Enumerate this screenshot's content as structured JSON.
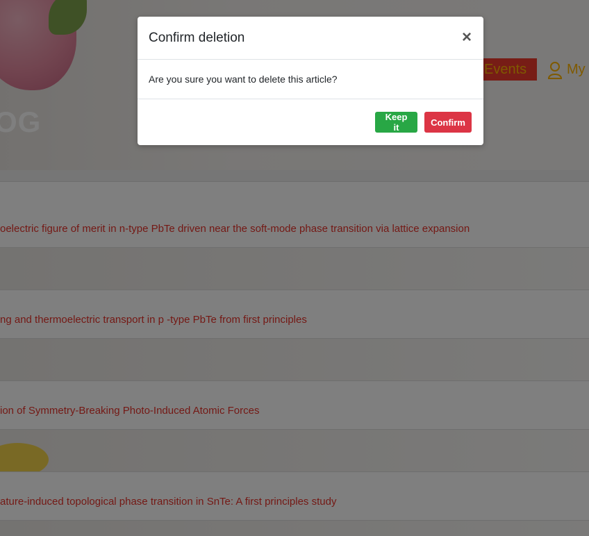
{
  "hero": {
    "title_fragment": "OG"
  },
  "nav": {
    "events_label": "Events",
    "my_label": "My"
  },
  "articles": [
    {
      "title": "oelectric figure of merit in n-type PbTe driven near the soft-mode phase transition via lattice expansion"
    },
    {
      "title": "ng and thermoelectric transport in p -type PbTe from first principles"
    },
    {
      "title": "ion of Symmetry-Breaking Photo-Induced Atomic Forces"
    },
    {
      "title": "ature-induced topological phase transition in SnTe: A first principles study"
    }
  ],
  "modal": {
    "title": "Confirm deletion",
    "close_symbol": "×",
    "body": "Are you sure you want to delete this article?",
    "keep_label": "Keep it",
    "confirm_label": "Confirm"
  },
  "colors": {
    "link": "#e8322a",
    "keep_button": "#28a745",
    "confirm_button": "#dc3545",
    "nav_accent": "#ffb400"
  }
}
